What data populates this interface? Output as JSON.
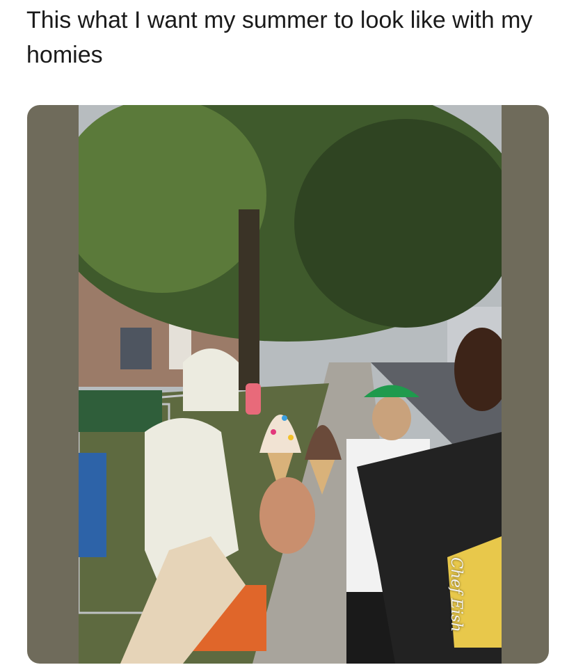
{
  "post": {
    "caption": "This what I want my summer to look like with my homies"
  },
  "photo": {
    "watermark": "Chef Eish",
    "scene": "ice-cream-cheers-photo",
    "colors": {
      "frame": "#6f6b5b",
      "foliage": "#3f5a2c",
      "hoodie": "#ecebe0",
      "shorts": "#e0662a",
      "cap": "#1f9a4d",
      "tshirt_dark": "#222222",
      "tshirt_white": "#f2f2f2"
    }
  }
}
